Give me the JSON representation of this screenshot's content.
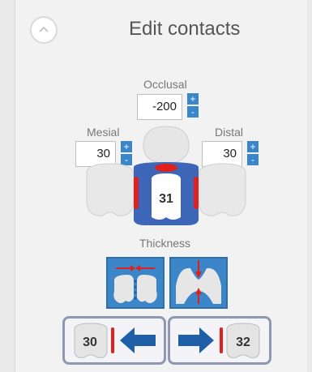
{
  "header": {
    "title": "Edit contacts"
  },
  "occlusal": {
    "label": "Occlusal",
    "value": "-200"
  },
  "mesial": {
    "label": "Mesial",
    "value": "30"
  },
  "distal": {
    "label": "Distal",
    "value": "30"
  },
  "stepper": {
    "plus": "+",
    "minus": "-"
  },
  "tooth": {
    "current": "31"
  },
  "thickness": {
    "label": "Thickness"
  },
  "nav": {
    "prev_tooth": "30",
    "next_tooth": "32"
  },
  "colors": {
    "accent": "#3a86c8",
    "contact": "#e0201c",
    "arrow": "#1f5fa8"
  }
}
